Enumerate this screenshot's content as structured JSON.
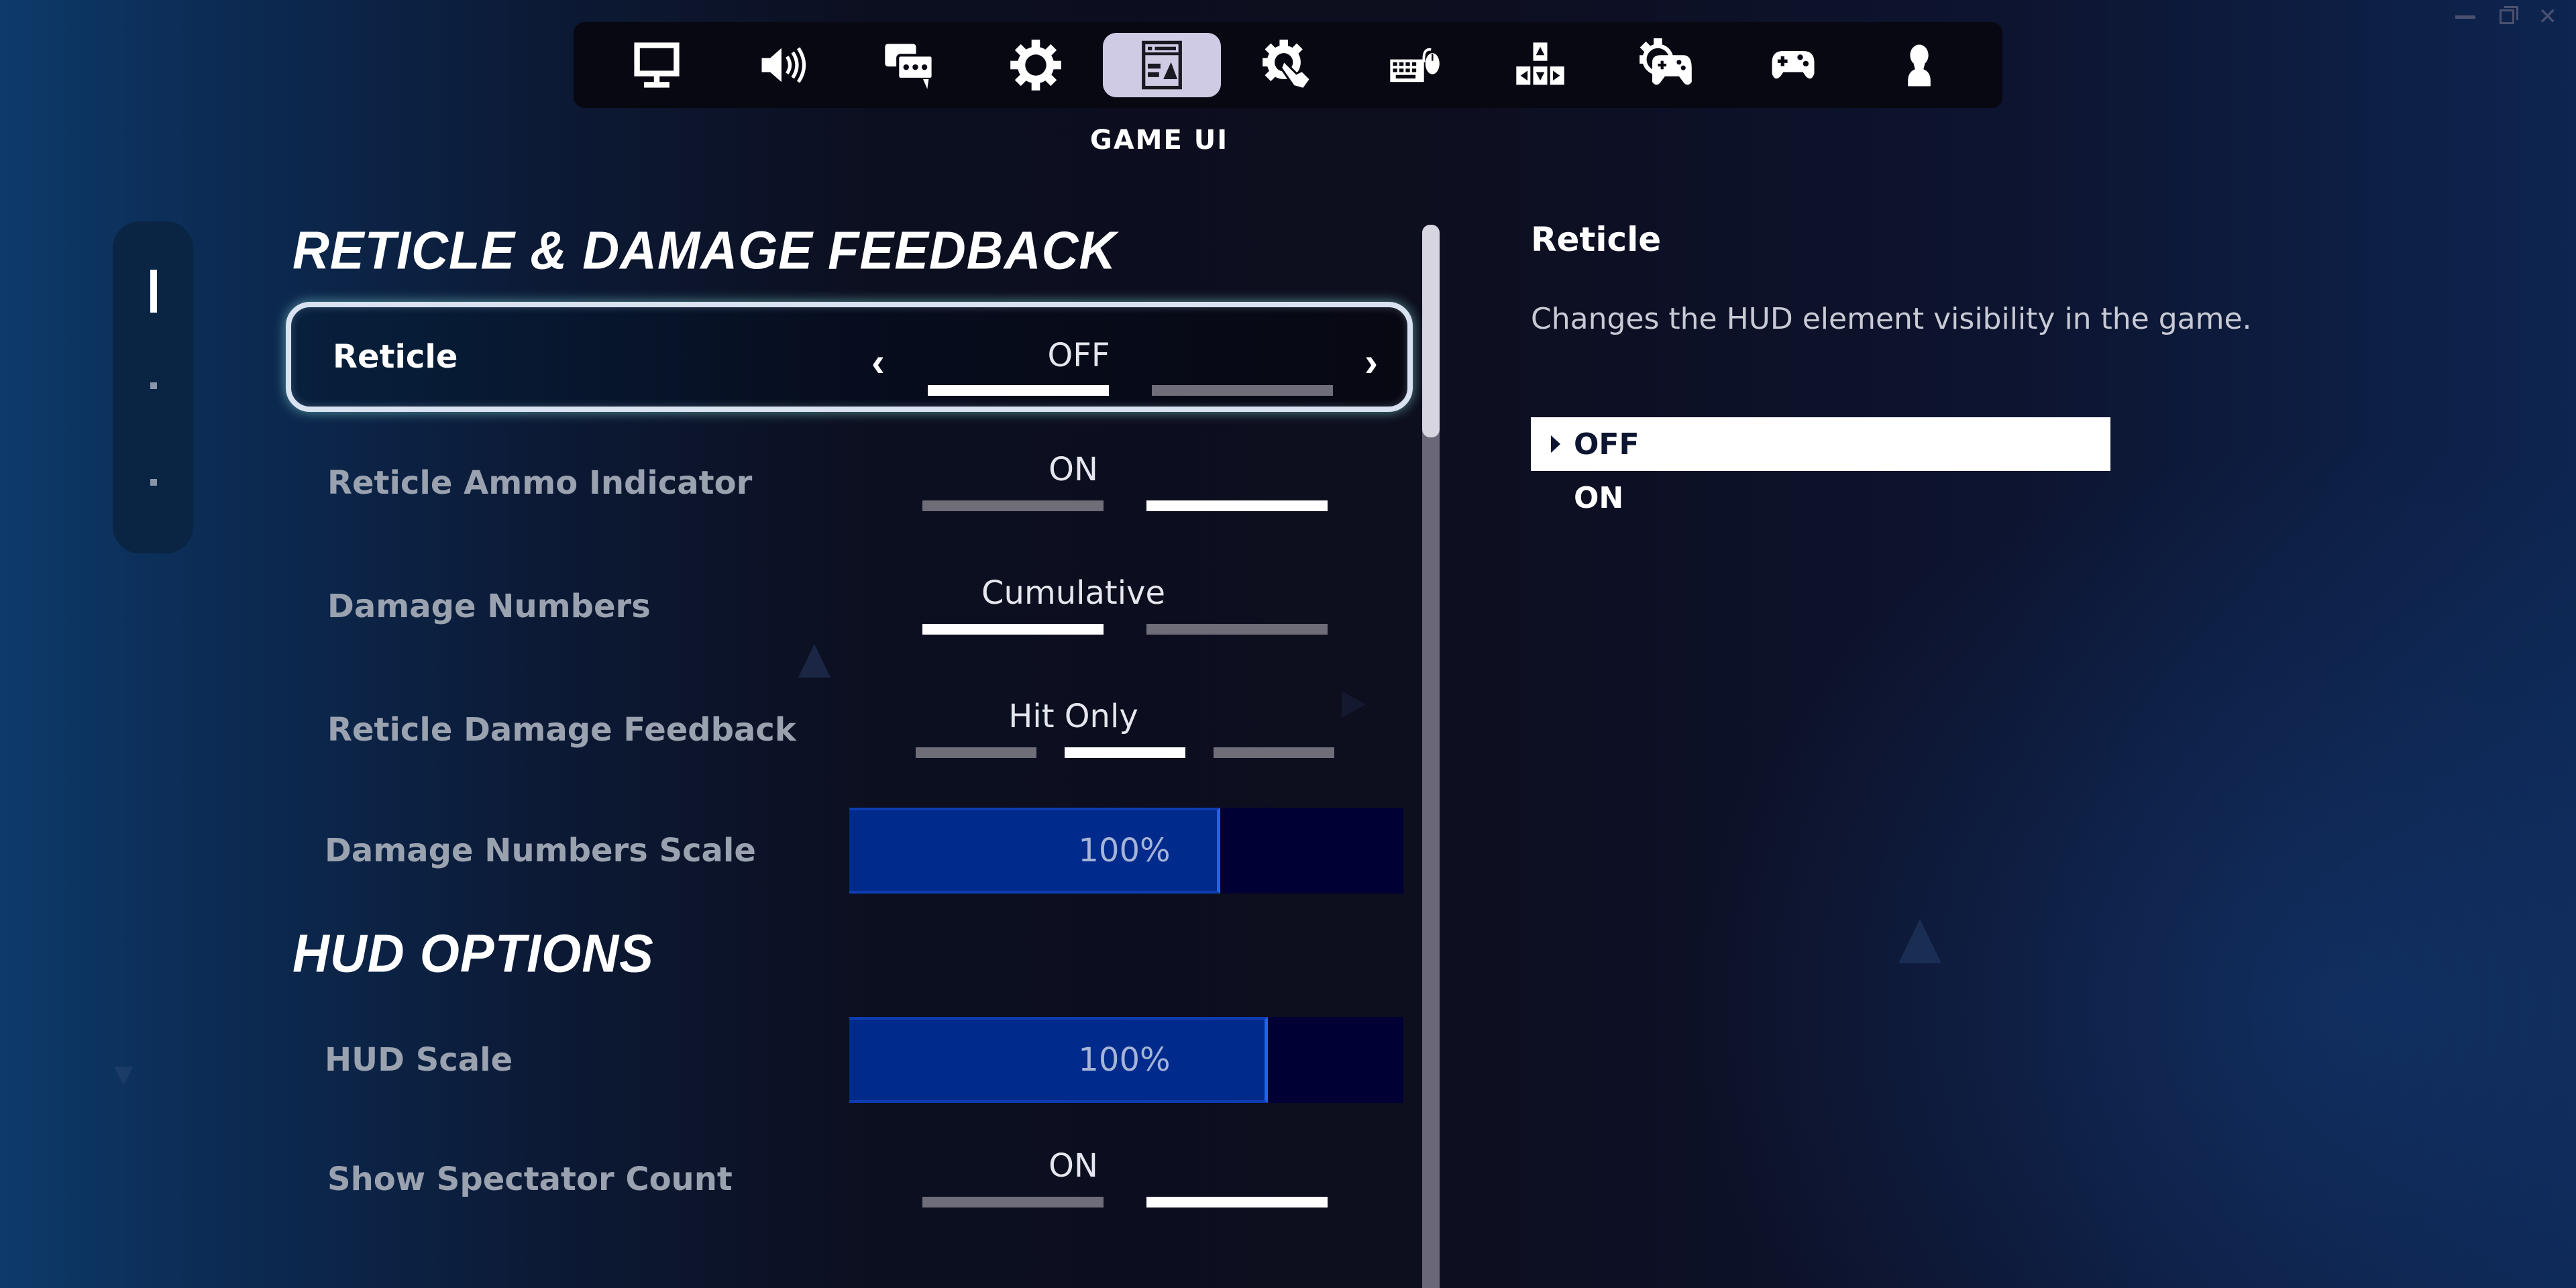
{
  "window_controls": {
    "minimize": "minimize",
    "restore": "restore",
    "close": "close"
  },
  "tabs": [
    {
      "id": "display",
      "icon": "monitor-icon",
      "active": false
    },
    {
      "id": "audio",
      "icon": "speaker-icon",
      "active": false
    },
    {
      "id": "social",
      "icon": "chat-bubbles-icon",
      "active": false
    },
    {
      "id": "game",
      "icon": "gear-icon",
      "active": false
    },
    {
      "id": "game-ui",
      "icon": "game-ui-layout-icon",
      "active": true
    },
    {
      "id": "touch",
      "icon": "gear-touch-icon",
      "active": false
    },
    {
      "id": "keyboard-mouse",
      "icon": "keyboard-mouse-icon",
      "active": false
    },
    {
      "id": "keybinds",
      "icon": "arrow-keys-icon",
      "active": false
    },
    {
      "id": "controller-settings",
      "icon": "gear-controller-icon",
      "active": false
    },
    {
      "id": "controller",
      "icon": "controller-icon",
      "active": false
    },
    {
      "id": "account",
      "icon": "user-icon",
      "active": false
    }
  ],
  "active_tab_title": "GAME UI",
  "section_nav": {
    "count": 3,
    "active_index": 0
  },
  "sections": [
    {
      "heading": "RETICLE & DAMAGE FEEDBACK"
    },
    {
      "heading": "HUD OPTIONS"
    }
  ],
  "settings": [
    {
      "label": "Reticle",
      "type": "toggle",
      "value": "OFF",
      "options": 2,
      "selected": 0,
      "focused": true
    },
    {
      "label": "Reticle Ammo Indicator",
      "type": "toggle",
      "value": "ON",
      "options": 2,
      "selected": 1
    },
    {
      "label": "Damage Numbers",
      "type": "toggle",
      "value": "Cumulative",
      "options": 2,
      "selected": 0
    },
    {
      "label": "Reticle Damage Feedback",
      "type": "toggle",
      "value": "Hit Only",
      "options": 3,
      "selected": 1
    },
    {
      "label": "Damage Numbers Scale",
      "type": "slider",
      "value": "100%",
      "fill_fraction": 0.67
    },
    {
      "label": "HUD Scale",
      "type": "slider",
      "value": "100%",
      "fill_fraction": 0.755
    },
    {
      "label": "Show Spectator Count",
      "type": "toggle",
      "value": "ON",
      "options": 2,
      "selected": 1
    }
  ],
  "scrollbar": {
    "thumb_fraction": 0.2
  },
  "detail": {
    "title": "Reticle",
    "description": "Changes the HUD element visibility in the game.",
    "options": [
      {
        "label": "OFF",
        "selected": true
      },
      {
        "label": "ON",
        "selected": false
      }
    ]
  },
  "colors": {
    "active_tab_bg": "#d0cbe4",
    "slider_fill": "#002a8c",
    "slider_track": "#000034",
    "pip_on": "#ffffff",
    "pip_off": "#6e6d78"
  }
}
